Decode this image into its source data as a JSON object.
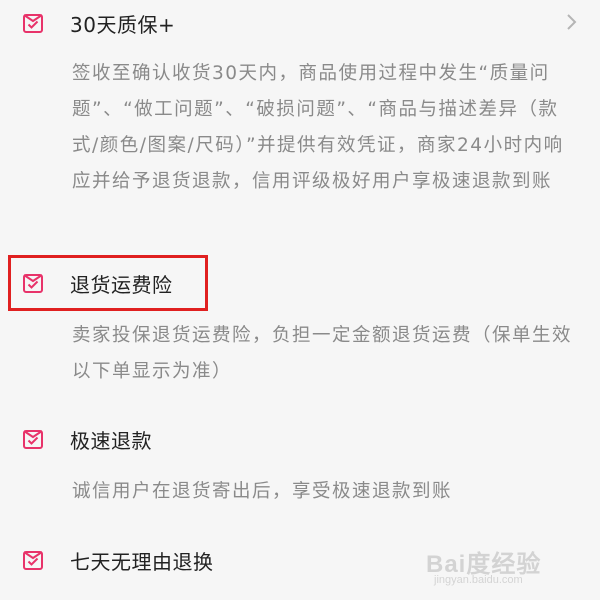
{
  "sections": [
    {
      "title": "30天质保+",
      "description": "签收至确认收货30天内，商品使用过程中发生“质量问题”、“做工问题”、“破损问题”、“商品与描述差异（款式/颜色/图案/尺码）”并提供有效凭证，商家24小时内响应并给予退货退款，信用评级极好用户享极速退款到账",
      "icon": "checkmark-box-icon",
      "has_chevron": true
    },
    {
      "title": "退货运费险",
      "description": "卖家投保退货运费险，负担一定金额退货运费（保单生效以下单显示为准）",
      "icon": "checkmark-box-icon",
      "highlighted": true
    },
    {
      "title": "极速退款",
      "description": "诚信用户在退货寄出后，享受极速退款到账",
      "icon": "checkmark-box-icon"
    },
    {
      "title": "七天无理由退换",
      "icon": "checkmark-box-icon"
    }
  ],
  "watermark": {
    "logo": "Bai度经验",
    "url": "jingyan.baidu.com"
  },
  "colors": {
    "accent": "#e8336a",
    "title_text": "#222222",
    "desc_text": "#8a8a8a",
    "background": "#f6f6f6",
    "highlight_border": "#e02020"
  }
}
